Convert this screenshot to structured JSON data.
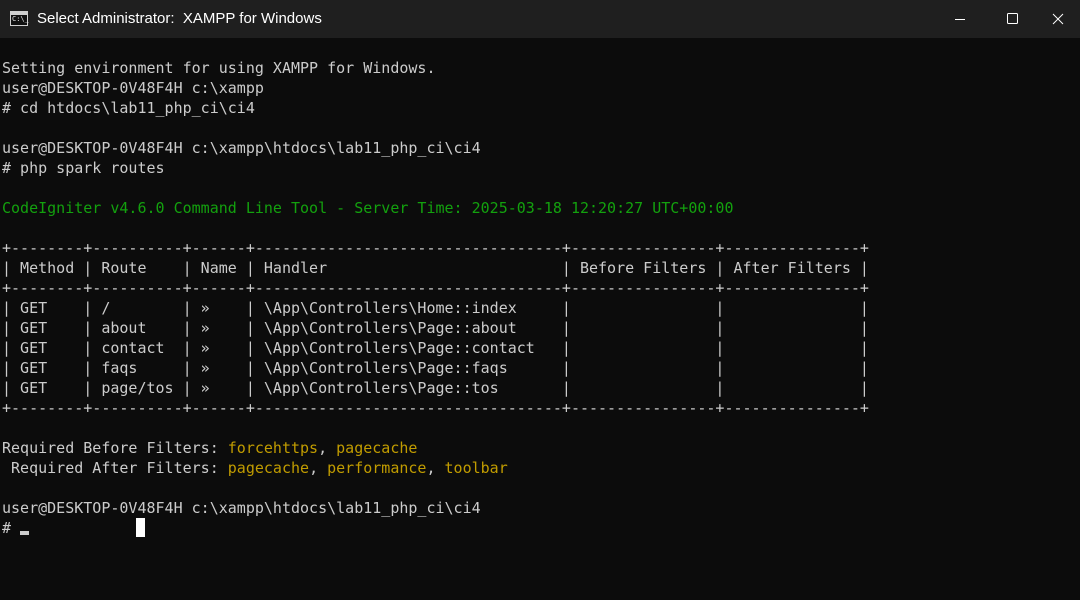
{
  "window": {
    "title": "Select Administrator:  XAMPP for Windows",
    "app_icon_glyph": "C:\\_",
    "controls": [
      "minimize",
      "maximize",
      "close"
    ]
  },
  "colors": {
    "background": "#0c0c0c",
    "titlebar": "#1f1f1f",
    "text": "#cccccc",
    "green": "#13a10e",
    "yellow": "#c19c00"
  },
  "console": {
    "env_line": "Setting environment for using XAMPP for Windows.",
    "prompt1": "user@DESKTOP-0V48F4H c:\\xampp",
    "cmd1": "# cd htdocs\\lab11_php_ci\\ci4",
    "prompt2": "user@DESKTOP-0V48F4H c:\\xampp\\htdocs\\lab11_php_ci\\ci4",
    "cmd2": "# php spark routes",
    "ci_banner": "CodeIgniter v4.6.0 Command Line Tool - Server Time: 2025-03-18 12:20:27 UTC+00:00",
    "table": {
      "border": "+--------+----------+------+----------------------------------+----------------+---------------+",
      "header": "| Method | Route    | Name | Handler                          | Before Filters | After Filters |",
      "rows": [
        "| GET    | /        | »    | \\App\\Controllers\\Home::index     |                |               |",
        "| GET    | about    | »    | \\App\\Controllers\\Page::about     |                |               |",
        "| GET    | contact  | »    | \\App\\Controllers\\Page::contact   |                |               |",
        "| GET    | faqs     | »    | \\App\\Controllers\\Page::faqs      |                |               |",
        "| GET    | page/tos | »    | \\App\\Controllers\\Page::tos       |                |               |"
      ]
    },
    "required_before": {
      "label": "Required Before Filters: ",
      "filter1": "forcehttps",
      "sep": ", ",
      "filter2": "pagecache"
    },
    "required_after": {
      "label": " Required After Filters: ",
      "filter1": "pagecache",
      "sep1": ", ",
      "filter2": "performance",
      "sep2": ", ",
      "filter3": "toolbar"
    },
    "prompt3": "user@DESKTOP-0V48F4H c:\\xampp\\htdocs\\lab11_php_ci\\ci4",
    "prompt_symbol": "# "
  }
}
